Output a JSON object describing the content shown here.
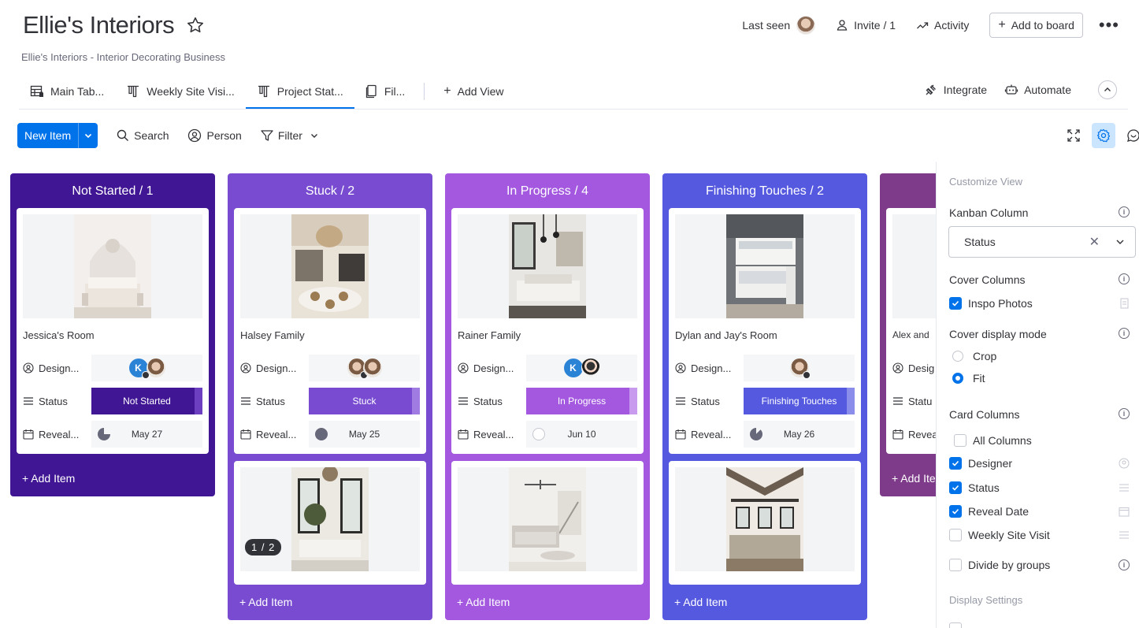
{
  "header": {
    "title": "Ellie's Interiors",
    "description": "Ellie's Interiors - Interior Decorating Business",
    "last_seen_label": "Last seen",
    "invite_label": "Invite / 1",
    "activity_label": "Activity",
    "add_to_board_label": "Add to board",
    "more_label": "•••"
  },
  "views": {
    "tabs": [
      {
        "label": "Main Tab...",
        "icon": "table-icon"
      },
      {
        "label": "Weekly Site Visi...",
        "icon": "kanban-icon"
      },
      {
        "label": "Project Stat...",
        "icon": "kanban-icon",
        "active": true
      },
      {
        "label": "Fil...",
        "icon": "file-icon"
      }
    ],
    "add_view_label": "Add View",
    "integrate_label": "Integrate",
    "automate_label": "Automate"
  },
  "toolbar": {
    "new_item_label": "New Item",
    "search_label": "Search",
    "person_label": "Person",
    "filter_label": "Filter"
  },
  "columns": [
    {
      "title": "Not Started / 1",
      "color": "#401694",
      "add_item": "+ Add Item",
      "cards": [
        {
          "name": "Jessica's Room",
          "designer_label": "Design...",
          "status_label": "Status",
          "status": "Not Started",
          "status_color": "#401694",
          "date_label": "Reveal...",
          "date": "May 27"
        }
      ]
    },
    {
      "title": "Stuck / 2",
      "color": "#784bd1",
      "add_item": "+ Add Item",
      "cards": [
        {
          "name": "Halsey Family",
          "designer_label": "Design...",
          "status_label": "Status",
          "status": "Stuck",
          "status_color": "#784bd1",
          "date_label": "Reveal...",
          "date": "May 25"
        },
        {
          "pager": "1 / 2"
        }
      ]
    },
    {
      "title": "In Progress / 4",
      "color": "#a358df",
      "add_item": "+ Add Item",
      "cards": [
        {
          "name": "Rainer Family",
          "designer_label": "Design...",
          "status_label": "Status",
          "status": "In Progress",
          "status_color": "#a358df",
          "date_label": "Reveal...",
          "date": "Jun 10"
        }
      ]
    },
    {
      "title": "Finishing Touches / 2",
      "color": "#5559df",
      "add_item": "+ Add Item",
      "cards": [
        {
          "name": "Dylan and Jay's Room",
          "designer_label": "Design...",
          "status_label": "Status",
          "status": "Finishing Touches",
          "status_color": "#5559df",
          "date_label": "Reveal...",
          "date": "May 26"
        }
      ]
    },
    {
      "title": "",
      "color": "#7e3b8a",
      "add_item": "+ Add Ite",
      "cards": [
        {
          "name": "Alex and",
          "designer_label": "Desig",
          "status_label": "Statu",
          "date_label": "Revea"
        }
      ]
    }
  ],
  "panel": {
    "title": "Customize View",
    "kanban_column_label": "Kanban Column",
    "kanban_column_value": "Status",
    "cover_columns_label": "Cover Columns",
    "cover_columns": [
      {
        "label": "Inspo Photos",
        "checked": true
      }
    ],
    "cover_mode_label": "Cover display mode",
    "cover_modes": [
      {
        "label": "Crop",
        "selected": false
      },
      {
        "label": "Fit",
        "selected": true
      }
    ],
    "card_columns_label": "Card Columns",
    "card_columns": [
      {
        "label": "All Columns",
        "checked": false
      },
      {
        "label": "Designer",
        "checked": true
      },
      {
        "label": "Status",
        "checked": true
      },
      {
        "label": "Reveal Date",
        "checked": true
      },
      {
        "label": "Weekly Site Visit",
        "checked": false
      }
    ],
    "divide_groups_label": "Divide by groups",
    "display_settings_label": "Display Settings"
  }
}
